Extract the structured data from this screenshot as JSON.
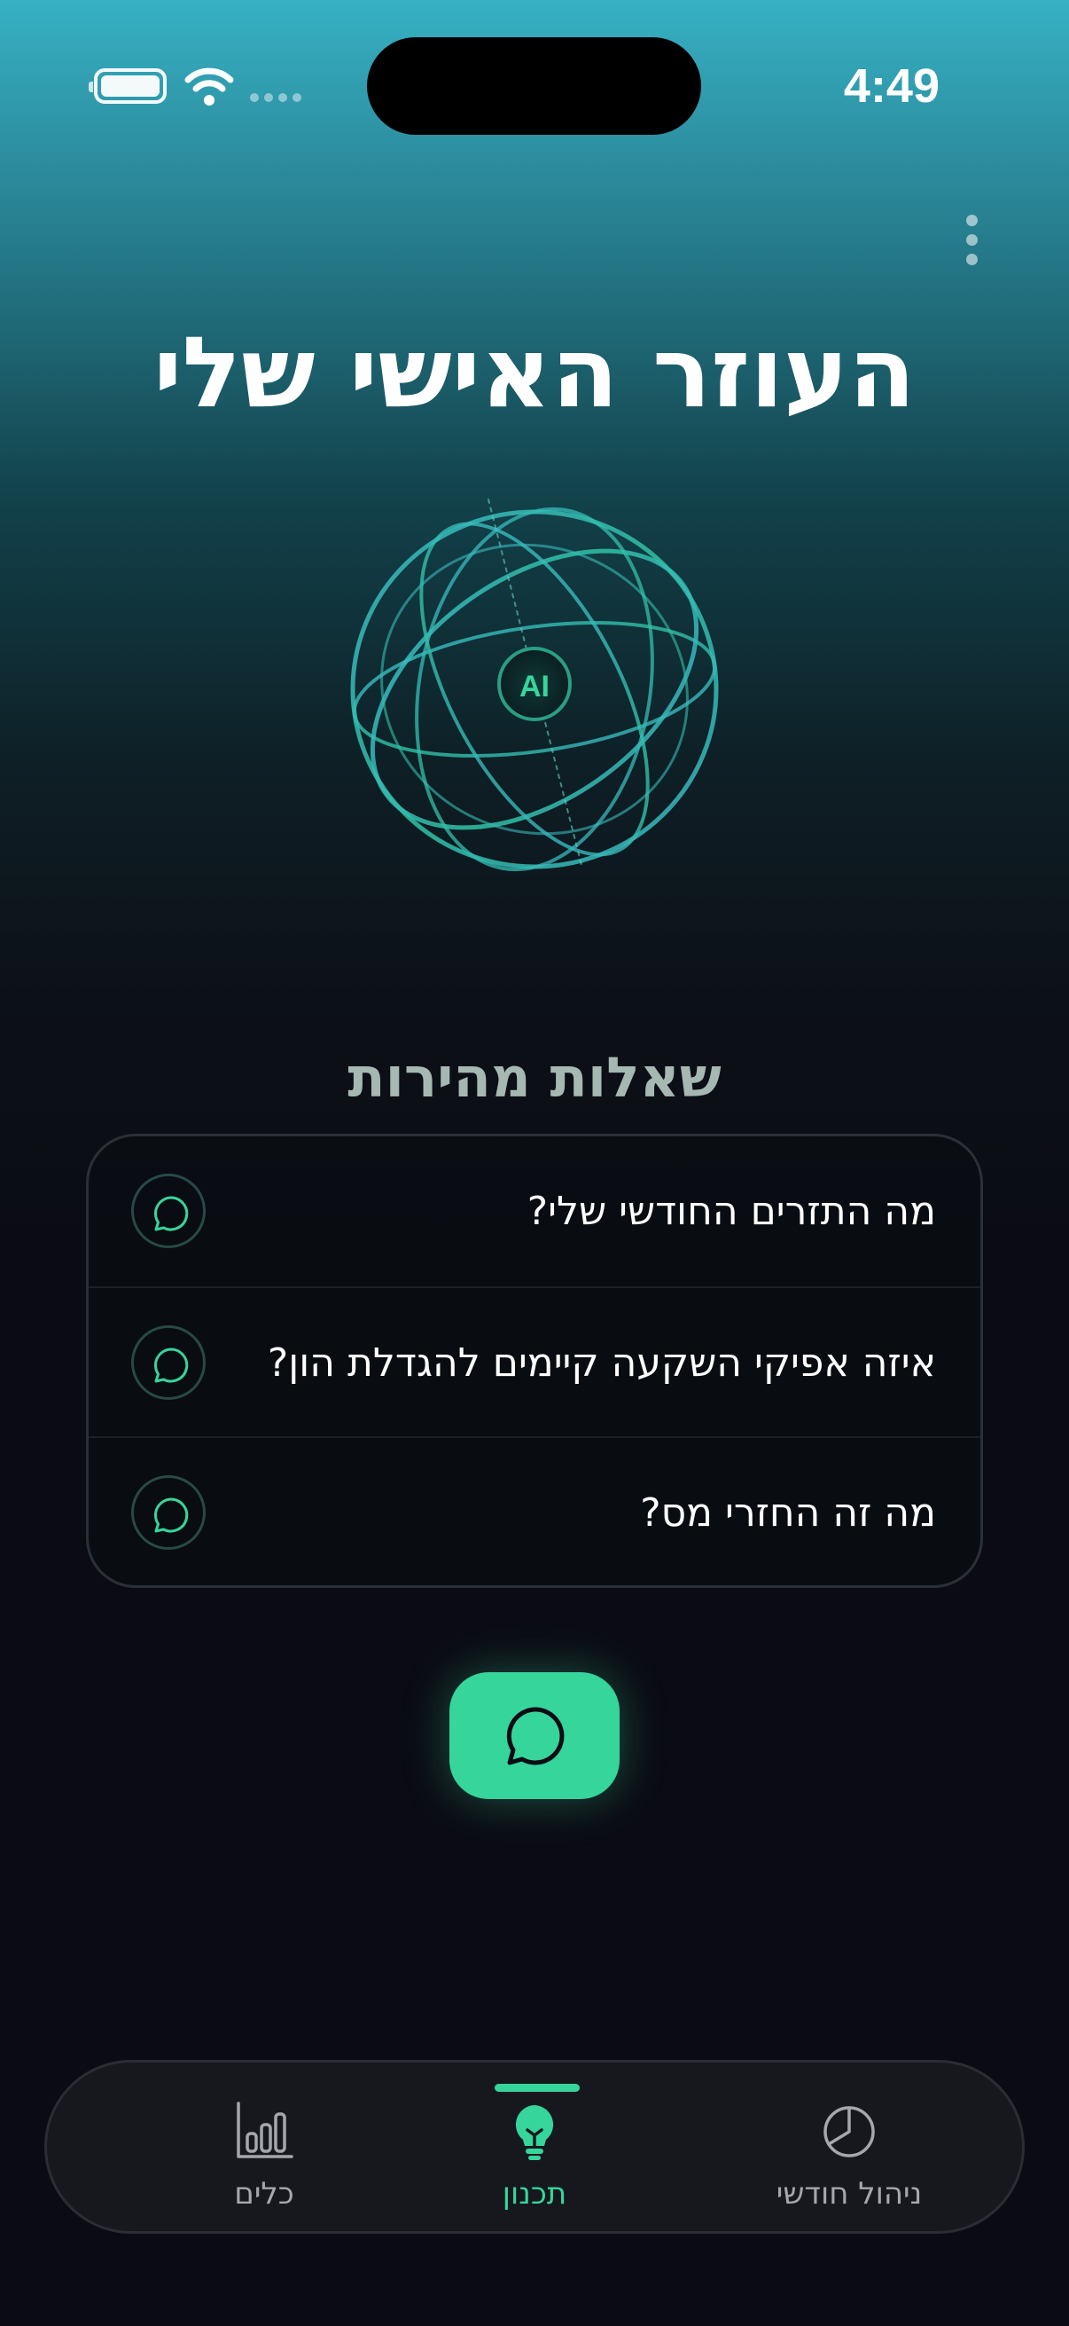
{
  "status_bar": {
    "time": "4:49",
    "icons": [
      "battery-icon",
      "wifi-icon",
      "signal-icon"
    ]
  },
  "header": {
    "title": "העוזר האישי שלי",
    "menu_icon": "more-vertical-icon"
  },
  "hero": {
    "badge": "AI",
    "icon": "ai-globe-icon"
  },
  "quick_questions": {
    "title": "שאלות מהירות",
    "items": [
      {
        "label": "מה התזרים החודשי שלי?",
        "icon": "chat-bubble-icon"
      },
      {
        "label": "איזה אפיקי השקעה קיימים להגדלת הון?",
        "icon": "chat-bubble-icon"
      },
      {
        "label": "מה זה החזרי מס?",
        "icon": "chat-bubble-icon"
      }
    ]
  },
  "chat_button": {
    "icon": "chat-bubble-icon"
  },
  "tab_bar": {
    "tabs": [
      {
        "label": "כלים",
        "icon": "bar-chart-icon",
        "active": false
      },
      {
        "label": "תכנון",
        "icon": "lightbulb-icon",
        "active": true
      },
      {
        "label": "ניהול חודשי",
        "icon": "pie-chart-icon",
        "active": false
      }
    ]
  },
  "colors": {
    "accent": "#36d59b",
    "background": "#0b0c13",
    "header_gradient_top": "#37b1c4",
    "globe_stroke": "#3cc6c0",
    "inactive_tab": "#a4a8ad"
  }
}
